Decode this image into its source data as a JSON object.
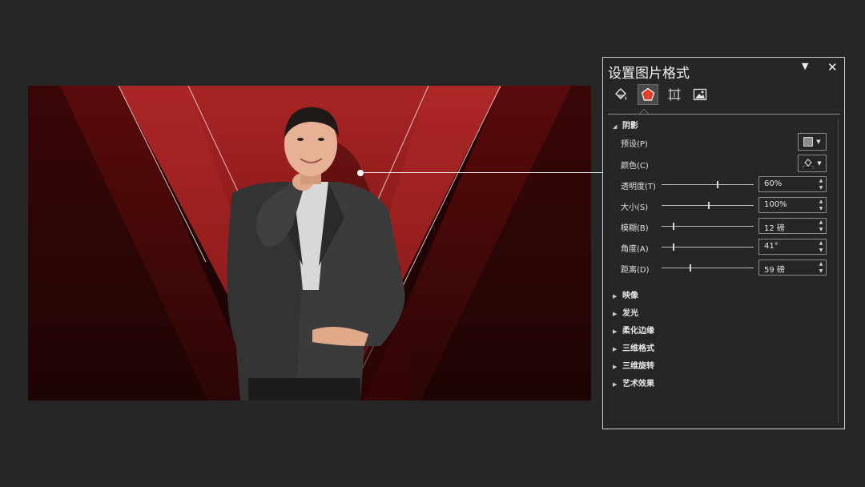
{
  "panel": {
    "title": "设置图片格式",
    "menu_icon": "▼",
    "close_icon": "✕",
    "tabs": [
      {
        "name": "fill-line",
        "icon": "paint-bucket-icon",
        "active": false
      },
      {
        "name": "effects",
        "icon": "pentagon-icon",
        "active": true
      },
      {
        "name": "size-properties",
        "icon": "size-grid-icon",
        "active": false
      },
      {
        "name": "picture",
        "icon": "image-icon",
        "active": false
      }
    ],
    "shadow": {
      "heading": "阴影",
      "expanded": true,
      "preset_label": "预设(P)",
      "color_label": "颜色(C)",
      "transparency": {
        "label": "透明度(T)",
        "value": "60%",
        "level": 0.6
      },
      "size": {
        "label": "大小(S)",
        "value": "100%",
        "level": 0.5
      },
      "blur": {
        "label": "模糊(B)",
        "value": "12 磅",
        "level": 0.12
      },
      "angle": {
        "label": "角度(A)",
        "value": "41°",
        "level": 0.12
      },
      "distance": {
        "label": "距离(D)",
        "value": "59 磅",
        "level": 0.3
      }
    },
    "collapsed_sections": [
      "映像",
      "发光",
      "柔化边缘",
      "三维格式",
      "三维旋转",
      "艺术效果"
    ]
  },
  "colors": {
    "background": "#262626",
    "slide_red": "#8e1919",
    "slide_dark": "#1a0505",
    "panel_border": "#d0d0d0"
  },
  "slide": {
    "image": "man-in-suit-photo"
  }
}
